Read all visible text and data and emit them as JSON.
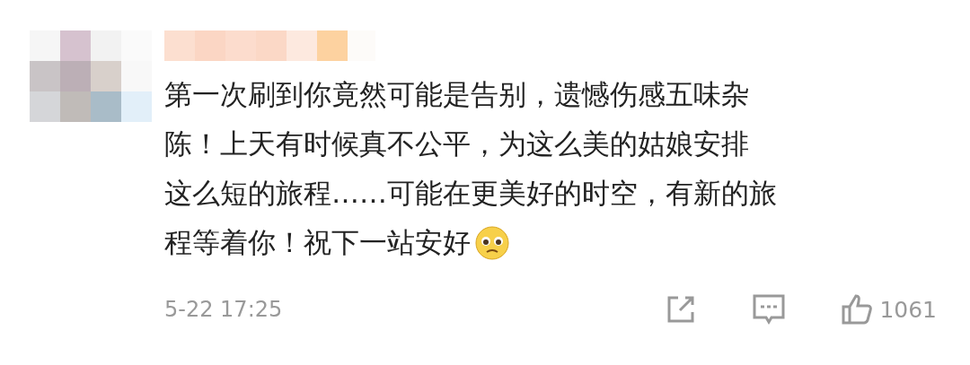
{
  "comment": {
    "lines": [
      "第一次刷到你竟然可能是告别，遗憾伤感五味杂",
      "陈！上天有时候真不公平，为这么美的姑娘安排",
      "这么短的旅程……可能在更美好的时空，有新的旅",
      "程等着你！祝下一站安好"
    ],
    "time": "5-22 17:25",
    "likes": "1061"
  }
}
